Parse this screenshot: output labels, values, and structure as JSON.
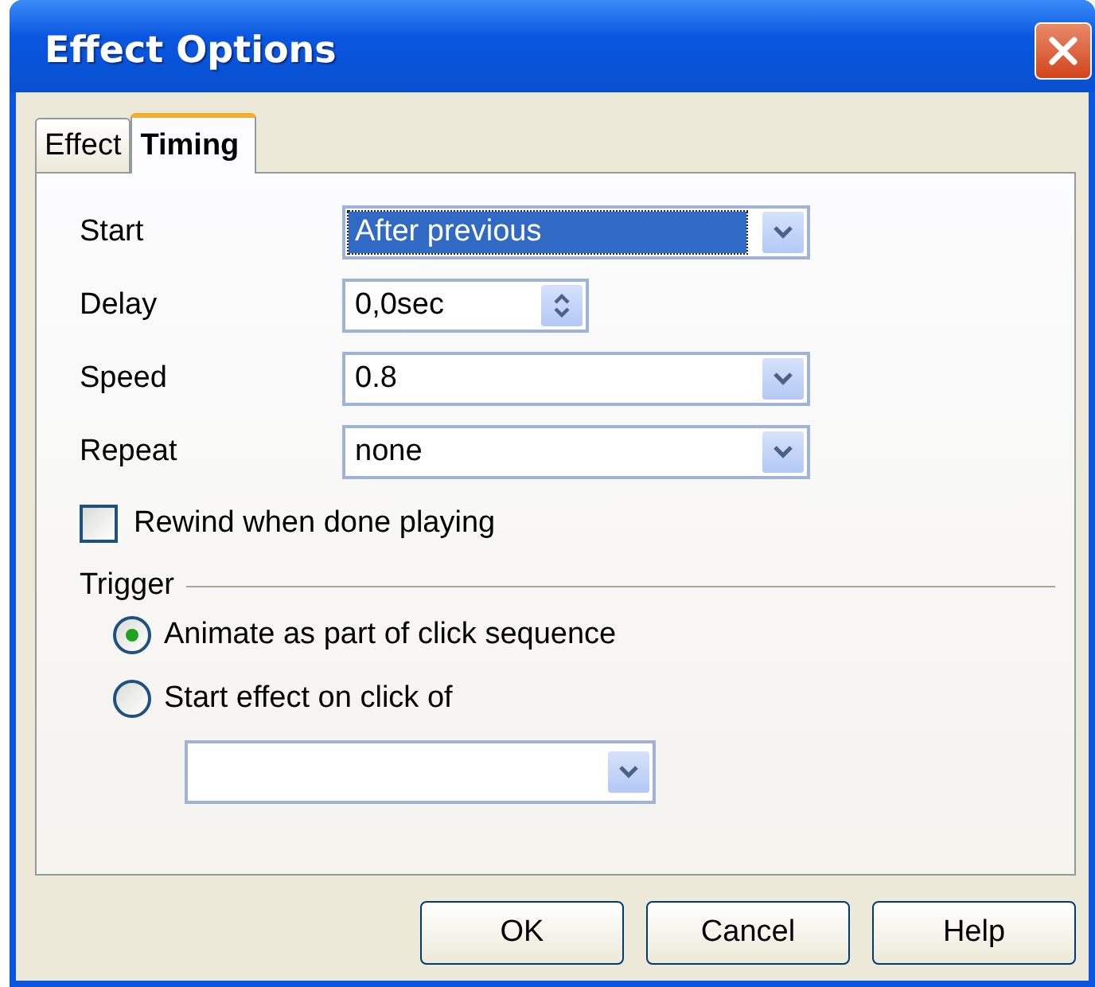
{
  "window": {
    "title": "Effect Options"
  },
  "tabs": [
    {
      "label": "Effect",
      "selected": false
    },
    {
      "label": "Timing",
      "selected": true
    }
  ],
  "fields": [
    {
      "kind": "dropdown",
      "label": "Start",
      "value": "After previous",
      "focused": true
    },
    {
      "kind": "spin",
      "label": "Delay",
      "value": "0,0sec",
      "focused": false
    },
    {
      "kind": "dropdown",
      "label": "Speed",
      "value": "0.8",
      "focused": false
    },
    {
      "kind": "dropdown",
      "label": "Repeat",
      "value": "none",
      "focused": false
    }
  ],
  "rewind": {
    "label": "Rewind when done playing",
    "checked": false
  },
  "trigger": {
    "title": "Trigger",
    "options": [
      {
        "label": "Animate as part of click sequence",
        "selected": true
      },
      {
        "label": "Start effect on click of",
        "selected": false
      }
    ],
    "target": {
      "kind": "dropdown"
    }
  },
  "buttons": [
    "OK",
    "Cancel",
    "Help"
  ]
}
